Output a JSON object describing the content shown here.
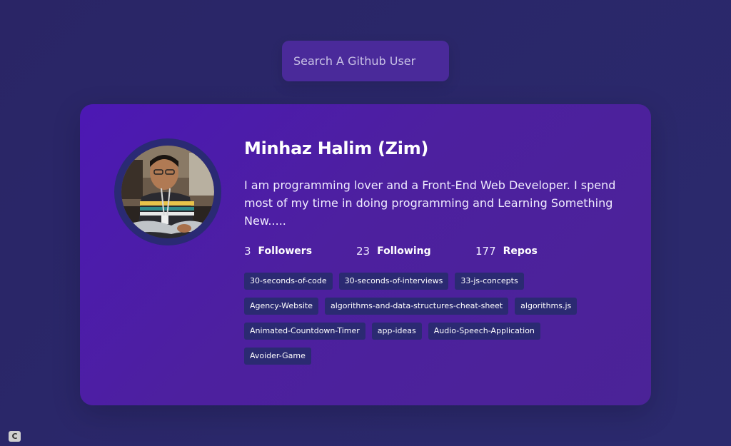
{
  "search": {
    "placeholder": "Search A Github User",
    "value": ""
  },
  "profile": {
    "name": "Minhaz Halim (Zim)",
    "bio": "I am programming lover and a Front-End Web Developer. I spend most of my time in doing programming and Learning Something New.....",
    "avatar_icon": "user-photo",
    "stats": {
      "followers_count": "3",
      "followers_label": "Followers",
      "following_count": "23",
      "following_label": "Following",
      "repos_count": "177",
      "repos_label": "Repos"
    },
    "repos": [
      "30-seconds-of-code",
      "30-seconds-of-interviews",
      "33-js-concepts",
      "Agency-Website",
      "algorithms-and-data-structures-cheat-sheet",
      "algorithms.js",
      "Animated-Countdown-Timer",
      "app-ideas",
      "Audio-Speech-Application",
      "Avoider-Game"
    ]
  },
  "corner_badge": "C",
  "colors": {
    "page_bg": "#2a2566",
    "card_bg": "#4c18b4",
    "search_bg": "#4a2a9a",
    "repo_tag_bg": "#2b2a72",
    "avatar_ring": "#2a2a74"
  }
}
